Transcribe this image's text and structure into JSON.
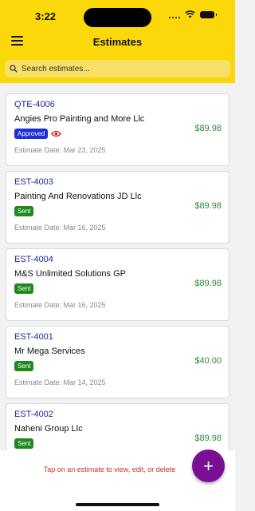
{
  "status_bar": {
    "time": "3:22"
  },
  "header": {
    "title": "Estimates",
    "menu_icon": "hamburger-menu-icon"
  },
  "search": {
    "placeholder": "Search estimates...",
    "value": "",
    "icon": "search-icon"
  },
  "estimates": [
    {
      "number": "QTE-4006",
      "client": "Angies Pro Painting and More Llc",
      "status": "Approved",
      "viewed_icon": "eye-icon",
      "date": "Estimate Date: Mar 23, 2025",
      "amount": "$89.98"
    },
    {
      "number": "EST-4003",
      "client": "Painting And Renovations JD Llc",
      "status": "Sent",
      "date": "Estimate Date: Mar 16, 2025",
      "amount": "$89.98"
    },
    {
      "number": "EST-4004",
      "client": "M&S Unlimited Solutions GP",
      "status": "Sent",
      "date": "Estimate Date: Mar 16, 2025",
      "amount": "$89.98"
    },
    {
      "number": "EST-4001",
      "client": "Mr Mega Services",
      "status": "Sent",
      "date": "Estimate Date: Mar 14, 2025",
      "amount": "$40.00"
    },
    {
      "number": "EST-4002",
      "client": "Naheni Group Llc",
      "status": "Sent",
      "date": "",
      "amount": "$89.98"
    }
  ],
  "footer": {
    "hint": "Tap on an estimate to view, edit, or delete",
    "add_label": "+"
  },
  "colors": {
    "header_bg": "#fbd80a",
    "approved": "#1f2fd6",
    "sent": "#1e8a1e",
    "amount": "#2f8a3a",
    "fab": "#7b0f93",
    "hint": "#c8322c"
  }
}
